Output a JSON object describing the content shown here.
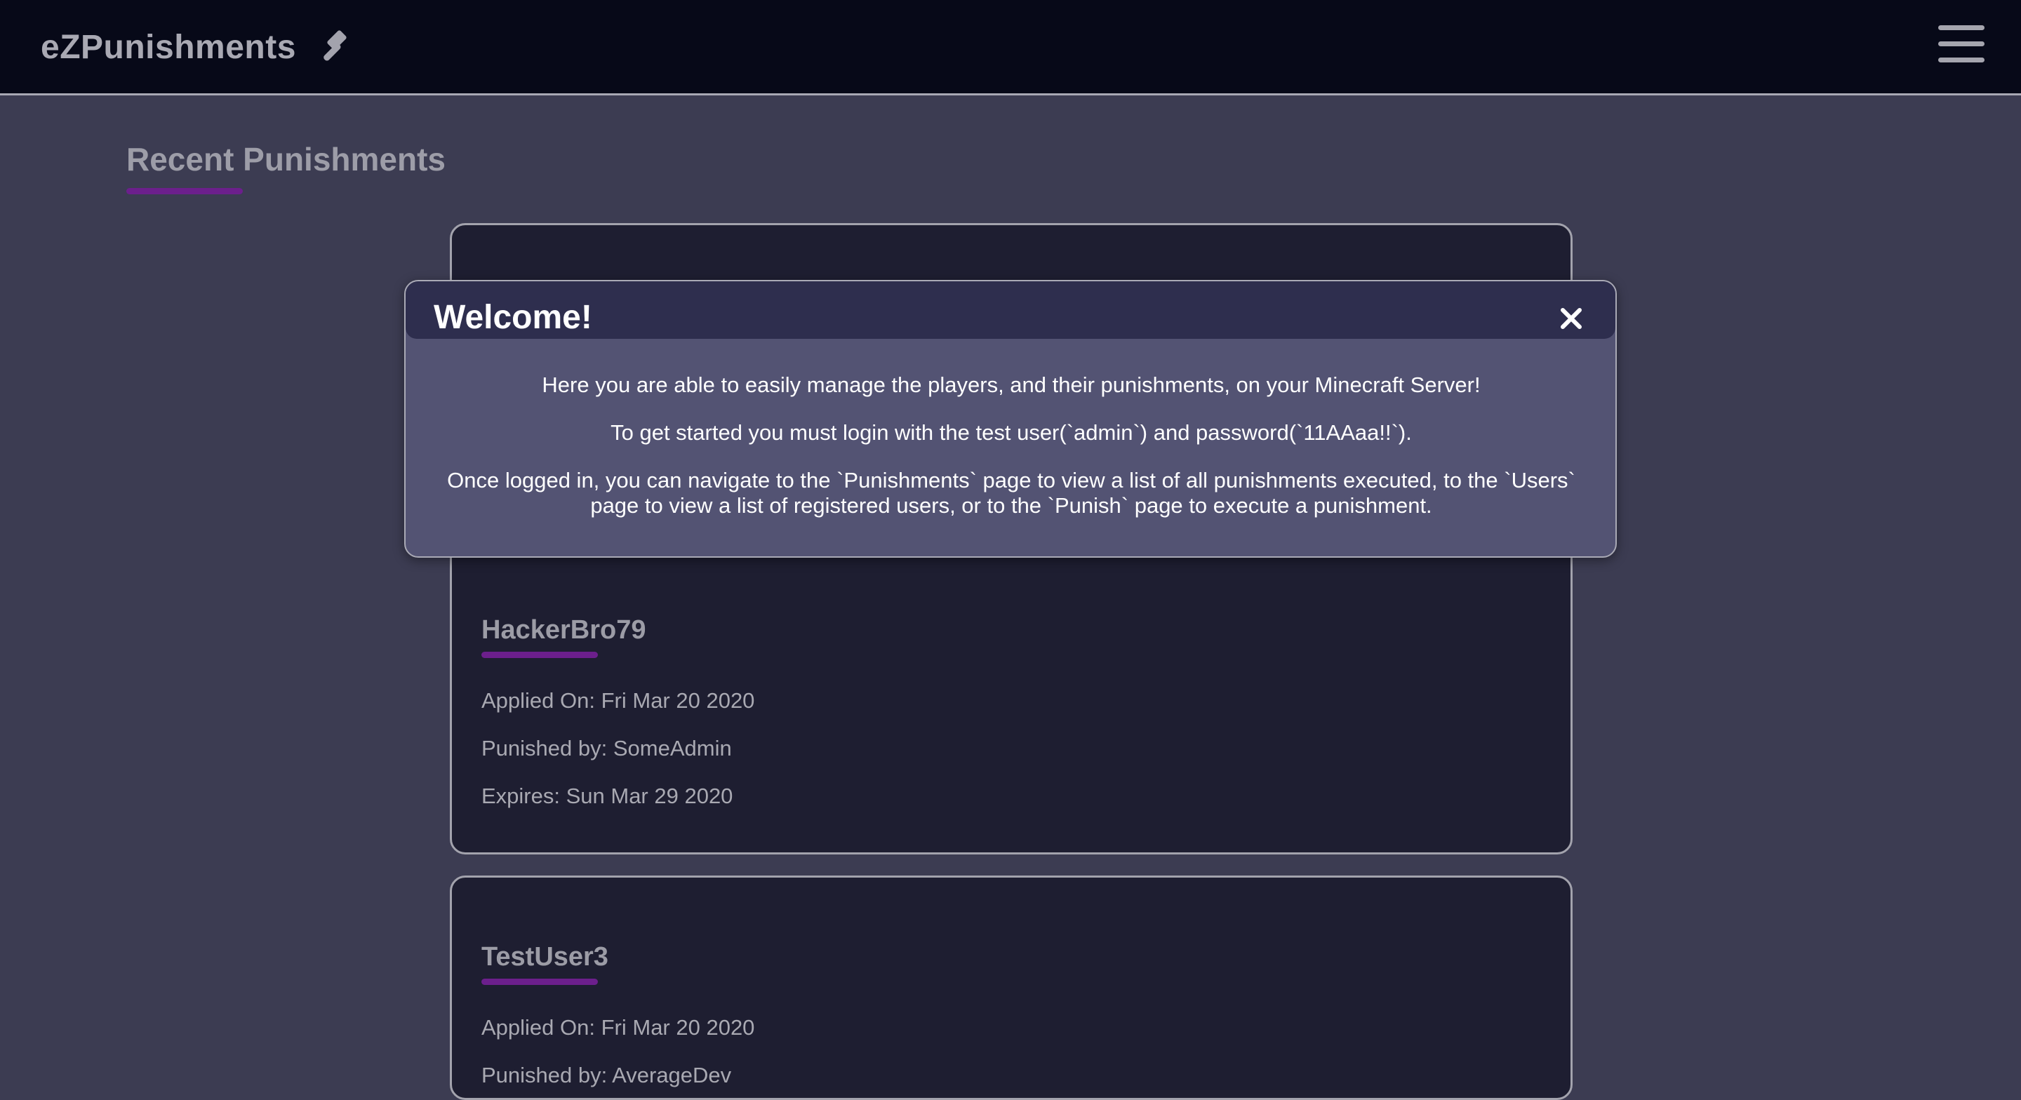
{
  "nav": {
    "brand": "eZPunishments",
    "brand_icon": "gavel-icon",
    "menu_icon": "hamburger-menu-icon"
  },
  "page": {
    "title": "Recent Punishments"
  },
  "punishments": [
    {
      "name": "HackerBro79",
      "applied": "Applied On: Fri Mar 20 2020",
      "punisher": "Punished by: SomeAdmin",
      "expires": "Expires: Sun Mar 29 2020"
    },
    {
      "name": "TestUser3",
      "applied": "Applied On: Fri Mar 20 2020",
      "punisher": "Punished by: AverageDev"
    }
  ],
  "modal": {
    "title": "Welcome!",
    "close_icon": "close-icon",
    "paragraphs": [
      "Here you are able to easily manage the players, and their punishments, on your Minecraft Server!",
      "To get started you must login with the test user(`admin`) and password(`11AAaa!!`).",
      "Once logged in, you can navigate to the `Punishments` page to view a list of all punishments executed, to the `Users` page to view a list of registered users, or to the `Punish` page to execute a punishment."
    ]
  },
  "colors": {
    "navbar": "#070918",
    "background": "#3c3c52",
    "card": "#1e1e31",
    "accent": "#6c1f8c",
    "modal": "#535373",
    "modal_header": "#2e2e4e"
  }
}
